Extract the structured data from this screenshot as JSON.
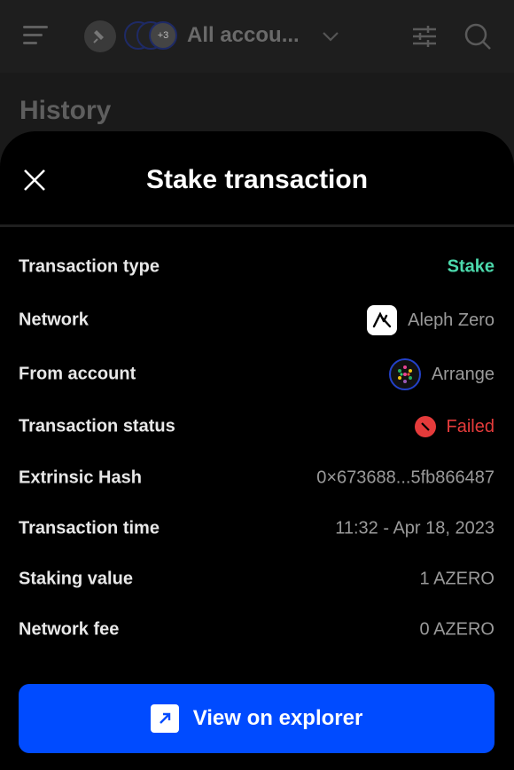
{
  "header": {
    "accounts_label": "All accou...",
    "extra_count": "+3",
    "section_title": "History"
  },
  "modal": {
    "title": "Stake transaction",
    "rows": [
      {
        "label": "Transaction type",
        "value": "Stake"
      },
      {
        "label": "Network",
        "value": "Aleph Zero"
      },
      {
        "label": "From account",
        "value": "Arrange"
      },
      {
        "label": "Transaction status",
        "value": "Failed"
      },
      {
        "label": "Extrinsic Hash",
        "value": "0×673688...5fb866487"
      },
      {
        "label": "Transaction time",
        "value": "11:32 - Apr 18, 2023"
      },
      {
        "label": "Staking value",
        "value": "1 AZERO"
      },
      {
        "label": "Network fee",
        "value": "0 AZERO"
      }
    ],
    "explorer_button": "View on explorer"
  },
  "colors": {
    "accent": "#004bff",
    "success": "#4cd9ac",
    "danger": "#e53b3b"
  },
  "icons": [
    "menu-icon",
    "plug-icon",
    "chevron-down-icon",
    "filter-icon",
    "search-icon",
    "close-icon",
    "aleph-zero-logo-icon",
    "failed-icon",
    "external-link-icon"
  ]
}
